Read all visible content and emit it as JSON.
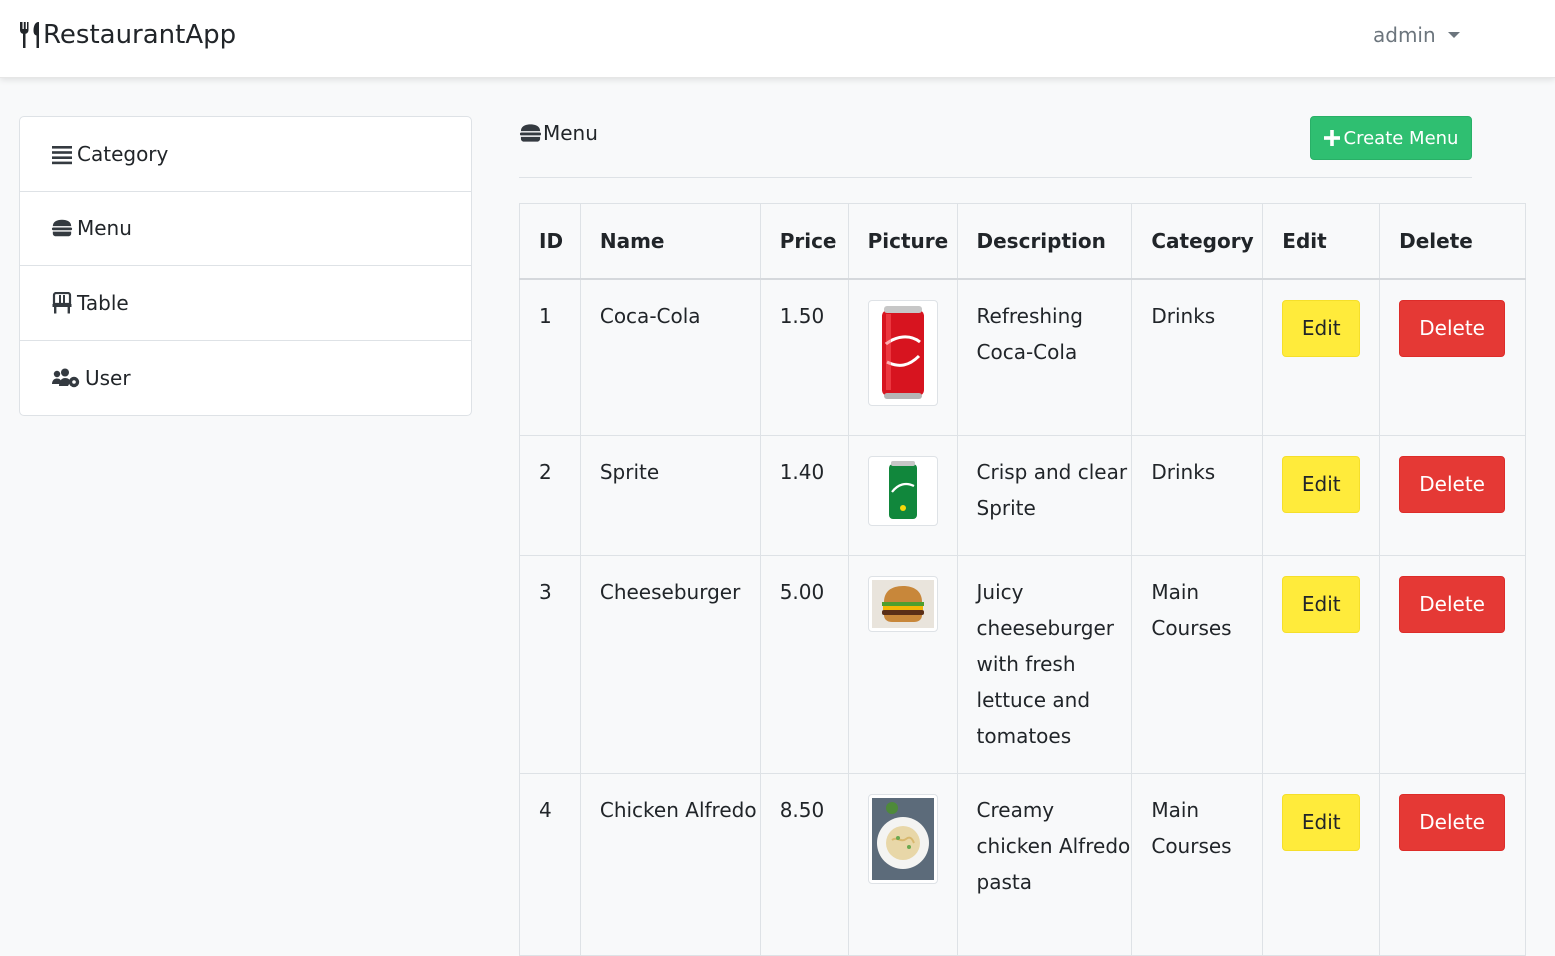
{
  "navbar": {
    "brand": "RestaurantApp",
    "user": "admin"
  },
  "sidebar": {
    "items": [
      {
        "label": "Category",
        "icon": "list-icon"
      },
      {
        "label": "Menu",
        "icon": "burger-icon"
      },
      {
        "label": "Table",
        "icon": "chair-icon"
      },
      {
        "label": "User",
        "icon": "users-cog-icon"
      }
    ]
  },
  "content": {
    "title": "Menu",
    "create_label": "Create Menu"
  },
  "table": {
    "headers": [
      "ID",
      "Name",
      "Price",
      "Picture",
      "Description",
      "Category",
      "Edit",
      "Delete"
    ],
    "rows": [
      {
        "id": "1",
        "name": "Coca-Cola",
        "price": "1.50",
        "picture": "coca-cola-can-image",
        "description": "Refreshing Coca-Cola",
        "category": "Drinks"
      },
      {
        "id": "2",
        "name": "Sprite",
        "price": "1.40",
        "picture": "sprite-can-image",
        "description": "Crisp and clear Sprite",
        "category": "Drinks"
      },
      {
        "id": "3",
        "name": "Cheeseburger",
        "price": "5.00",
        "picture": "cheeseburger-image",
        "description": "Juicy cheeseburger with fresh lettuce and tomatoes",
        "category": "Main Courses"
      },
      {
        "id": "4",
        "name": "Chicken Alfredo",
        "price": "8.50",
        "picture": "chicken-alfredo-image",
        "description": "Creamy chicken Alfredo pasta",
        "category": "Main Courses"
      }
    ],
    "edit_label": "Edit",
    "delete_label": "Delete"
  },
  "colors": {
    "create": "#2fbf71",
    "edit": "#ffeb3b",
    "delete": "#e53935"
  }
}
